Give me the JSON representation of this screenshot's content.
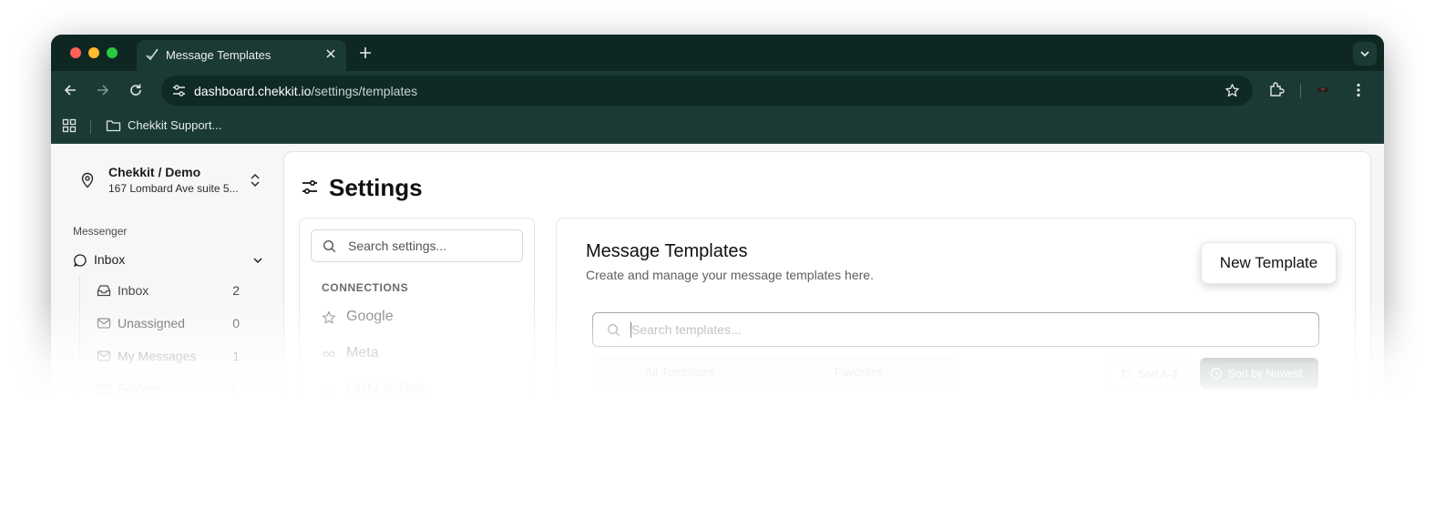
{
  "browser": {
    "tab_title": "Message Templates",
    "url_host": "dashboard.chekkit.io",
    "url_path": "/settings/templates",
    "bookmark_folder": "Chekkit Support..."
  },
  "location": {
    "name": "Chekkit / Demo",
    "address": "167 Lombard Ave suite 5..."
  },
  "sidebar": {
    "section": "Messenger",
    "group_label": "Inbox",
    "items": [
      {
        "label": "Inbox",
        "count": "2",
        "icon": "inbox-icon"
      },
      {
        "label": "Unassigned",
        "count": "0",
        "icon": "mail-icon"
      },
      {
        "label": "My Messages",
        "count": "1",
        "icon": "mail-icon"
      },
      {
        "label": "Folders",
        "count": "",
        "icon": "folder-icon"
      }
    ]
  },
  "settings": {
    "title": "Settings",
    "search_placeholder": "Search settings...",
    "section_heading": "CONNECTIONS",
    "nav_items": [
      {
        "label": "Google",
        "icon": "star-icon"
      },
      {
        "label": "Meta",
        "icon": "infinity-icon"
      },
      {
        "label": "CRM & Tools",
        "icon": "tools-icon"
      }
    ]
  },
  "templates": {
    "title": "Message Templates",
    "subtitle": "Create and manage your message templates here.",
    "new_button": "New Template",
    "search_placeholder": "Search templates...",
    "filter_all": "All Templates",
    "filter_favorites": "Favorites",
    "sort_az": "Sort A-Z",
    "sort_newest": "Sort by Newest"
  },
  "colors": {
    "chrome_dark": "#0e2723",
    "chrome_toolbar": "#1b3a35",
    "accent": "#2c4a45"
  }
}
